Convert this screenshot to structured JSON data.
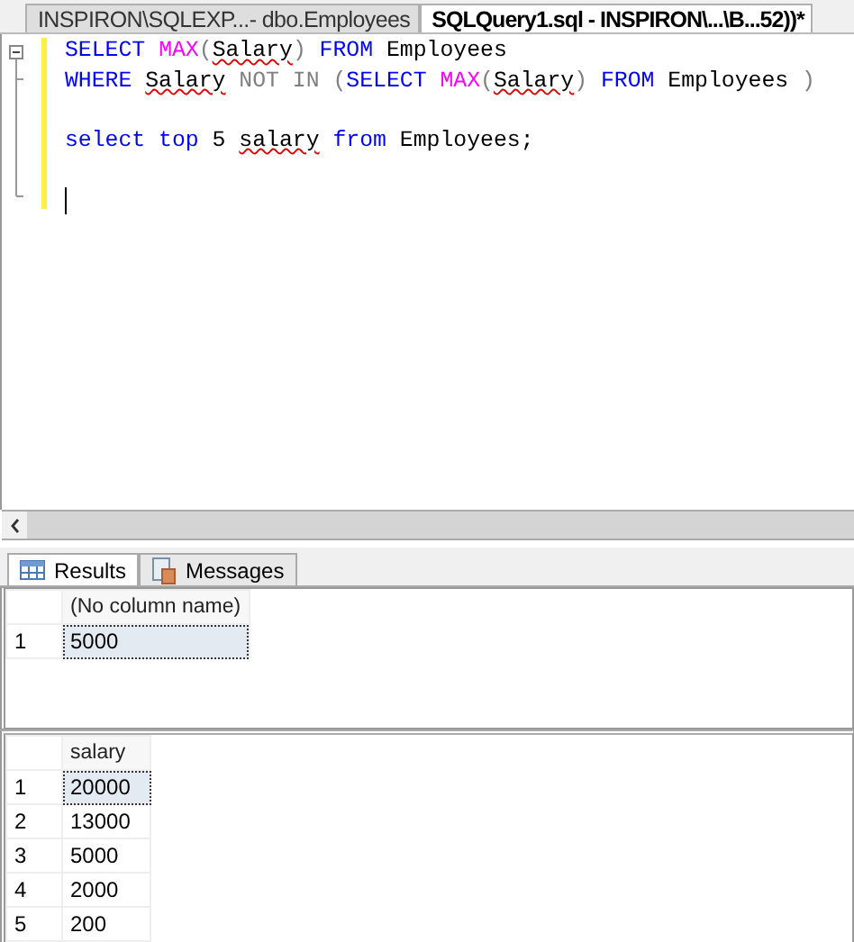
{
  "document_tabs": [
    {
      "label": "INSPIRON\\SQLEXP...- dbo.Employees",
      "selected": false
    },
    {
      "label": "SQLQuery1.sql - INSPIRON\\...\\B...52))*",
      "selected": true
    }
  ],
  "editor": {
    "lines": [
      {
        "kind": "code",
        "tokens": [
          {
            "kind": "keyword",
            "text": "SELECT "
          },
          {
            "kind": "function",
            "text": "MAX"
          },
          {
            "kind": "operator",
            "text": "("
          },
          {
            "kind": "flagged",
            "text": "Salary"
          },
          {
            "kind": "operator",
            "text": ")"
          },
          {
            "kind": "keyword",
            "text": " FROM "
          },
          {
            "kind": "plain",
            "text": "Employees"
          }
        ]
      },
      {
        "kind": "code",
        "tokens": [
          {
            "kind": "keyword",
            "text": "WHERE "
          },
          {
            "kind": "flagged",
            "text": "Salary"
          },
          {
            "kind": "operator",
            "text": " NOT IN ("
          },
          {
            "kind": "keyword",
            "text": "SELECT "
          },
          {
            "kind": "function",
            "text": "MAX"
          },
          {
            "kind": "operator",
            "text": "("
          },
          {
            "kind": "flagged",
            "text": "Salary"
          },
          {
            "kind": "operator",
            "text": ")"
          },
          {
            "kind": "keyword",
            "text": " FROM "
          },
          {
            "kind": "plain",
            "text": "Employees "
          },
          {
            "kind": "operator",
            "text": ")"
          }
        ]
      },
      {
        "kind": "blank"
      },
      {
        "kind": "code",
        "tokens": [
          {
            "kind": "keyword",
            "text": "select top "
          },
          {
            "kind": "plain",
            "text": "5 "
          },
          {
            "kind": "flagged",
            "text": "salary"
          },
          {
            "kind": "keyword",
            "text": " from "
          },
          {
            "kind": "plain",
            "text": "Employees;"
          }
        ]
      },
      {
        "kind": "blank"
      },
      {
        "kind": "cursor"
      }
    ]
  },
  "result_tabs": [
    {
      "label": "Results",
      "selected": true
    },
    {
      "label": "Messages",
      "selected": false
    }
  ],
  "grids": [
    {
      "columns": [
        "(No column name)"
      ],
      "rows": [
        {
          "number": "1",
          "cells": [
            "5000"
          ],
          "selected": true
        }
      ]
    },
    {
      "columns": [
        "salary"
      ],
      "rows": [
        {
          "number": "1",
          "cells": [
            "20000"
          ],
          "selected": true
        },
        {
          "number": "2",
          "cells": [
            "13000"
          ],
          "selected": false
        },
        {
          "number": "3",
          "cells": [
            "5000"
          ],
          "selected": false
        },
        {
          "number": "4",
          "cells": [
            "2000"
          ],
          "selected": false
        },
        {
          "number": "5",
          "cells": [
            "200"
          ],
          "selected": false
        }
      ]
    }
  ]
}
